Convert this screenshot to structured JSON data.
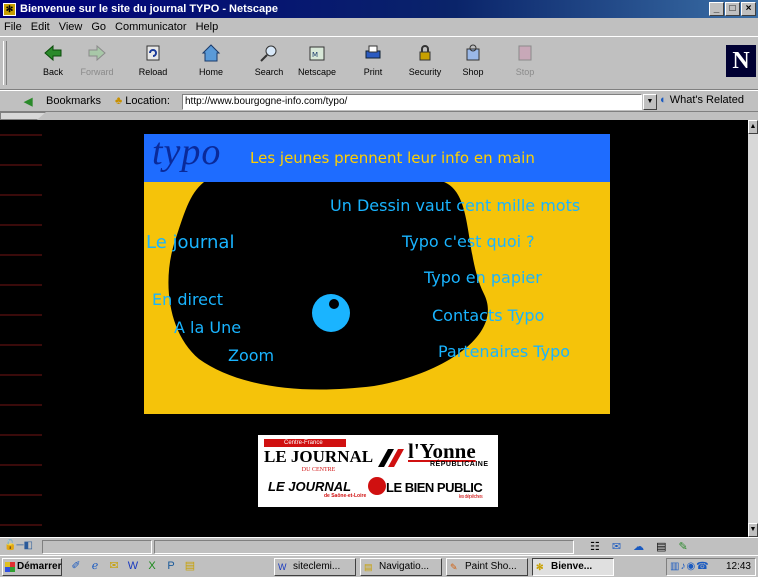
{
  "window": {
    "title": "Bienvenue sur le site du journal TYPO - Netscape",
    "controls": [
      "_",
      "□",
      "×"
    ]
  },
  "menu": [
    "File",
    "Edit",
    "View",
    "Go",
    "Communicator",
    "Help"
  ],
  "toolbar": {
    "buttons": [
      {
        "label": "Back",
        "icon": "back-arrow-icon",
        "enabled": true
      },
      {
        "label": "Forward",
        "icon": "forward-arrow-icon",
        "enabled": false
      },
      {
        "label": "Reload",
        "icon": "reload-icon",
        "enabled": true
      },
      {
        "label": "Home",
        "icon": "home-icon",
        "enabled": true
      },
      {
        "label": "Search",
        "icon": "search-icon",
        "enabled": true
      },
      {
        "label": "Netscape",
        "icon": "netscape-icon",
        "enabled": true
      },
      {
        "label": "Print",
        "icon": "print-icon",
        "enabled": true
      },
      {
        "label": "Security",
        "icon": "security-lock-icon",
        "enabled": true
      },
      {
        "label": "Shop",
        "icon": "shop-icon",
        "enabled": true
      },
      {
        "label": "Stop",
        "icon": "stop-icon",
        "enabled": false
      }
    ],
    "brand_letter": "N"
  },
  "location": {
    "bookmarks_label": "Bookmarks",
    "location_label": "Location:",
    "url": "http://www.bourgogne-info.com/typo/",
    "related_label": "What's Related"
  },
  "page": {
    "logo_text": "typo",
    "tagline": "Les jeunes prennent leur info en main",
    "links_right": [
      "Un Dessin vaut cent mille mots",
      "Typo c'est quoi ?",
      "Typo en papier",
      "Contacts Typo",
      "Partenaires Typo"
    ],
    "links_left": [
      "Le journal",
      "En direct",
      "A la Une",
      "Zoom"
    ],
    "colors": {
      "panel": "#f5c30a",
      "banner": "#1e6cff",
      "link": "#19b4ff",
      "tagline": "#ffd000"
    },
    "partners": {
      "lj1_top": "Centre-France",
      "lj1": "LE JOURNAL",
      "lj1_sub": "DU CENTRE",
      "yonne": "l'Yonne",
      "yonne_sub": "RÉPUBLICAINE",
      "lj2": "LE JOURNAL",
      "lj2_sub": "de Saône-et-Loire",
      "bp": "LE BIEN PUBLIC",
      "bp_sub": "les dépêches"
    }
  },
  "taskbar": {
    "start_label": "Démarrer",
    "tasks": [
      {
        "label": "siteclemi...",
        "icon": "word-doc-icon",
        "active": false
      },
      {
        "label": "Navigatio...",
        "icon": "explorer-folder-icon",
        "active": false
      },
      {
        "label": "Paint Sho...",
        "icon": "paint-shop-icon",
        "active": false
      },
      {
        "label": "Bienve...",
        "icon": "netscape-task-icon",
        "active": true
      }
    ],
    "clock": "12:43"
  }
}
